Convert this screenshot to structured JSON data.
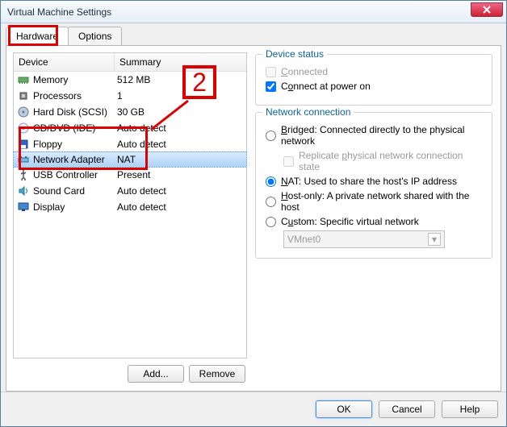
{
  "window": {
    "title": "Virtual Machine Settings"
  },
  "tabs": {
    "hardware": "Hardware",
    "options": "Options"
  },
  "list_header": {
    "device": "Device",
    "summary": "Summary"
  },
  "devices": [
    {
      "name": "Memory",
      "summary": "512 MB",
      "icon": "memory-icon"
    },
    {
      "name": "Processors",
      "summary": "1",
      "icon": "cpu-icon"
    },
    {
      "name": "Hard Disk (SCSI)",
      "summary": "30 GB",
      "icon": "disk-icon"
    },
    {
      "name": "CD/DVD (IDE)",
      "summary": "Auto detect",
      "icon": "cd-icon"
    },
    {
      "name": "Floppy",
      "summary": "Auto detect",
      "icon": "floppy-icon"
    },
    {
      "name": "Network Adapter",
      "summary": "NAT",
      "icon": "network-icon"
    },
    {
      "name": "USB Controller",
      "summary": "Present",
      "icon": "usb-icon"
    },
    {
      "name": "Sound Card",
      "summary": "Auto detect",
      "icon": "sound-icon"
    },
    {
      "name": "Display",
      "summary": "Auto detect",
      "icon": "display-icon"
    }
  ],
  "selected_device_index": 5,
  "left_buttons": {
    "add": "Add...",
    "remove": "Remove"
  },
  "device_status": {
    "title": "Device status",
    "connected": "Connected",
    "connect_power_on": "Connect at power on"
  },
  "network_connection": {
    "title": "Network connection",
    "bridged": "Bridged: Connected directly to the physical network",
    "replicate": "Replicate physical network connection state",
    "nat": "NAT: Used to share the host's IP address",
    "host_only": "Host-only: A private network shared with the host",
    "custom": "Custom: Specific virtual network",
    "custom_value": "VMnet0"
  },
  "footer": {
    "ok": "OK",
    "cancel": "Cancel",
    "help": "Help"
  },
  "callout": {
    "num": "2"
  }
}
